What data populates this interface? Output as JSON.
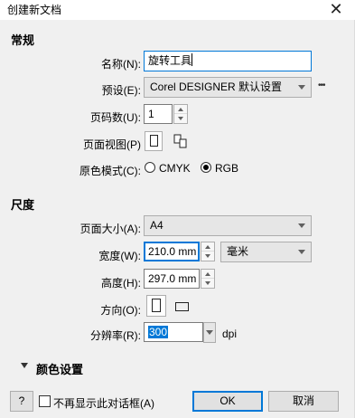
{
  "window": {
    "title": "创建新文档",
    "close_glyph": "✕"
  },
  "sections": {
    "general": "常规",
    "size": "尺度",
    "color": "颜色设置"
  },
  "fields": {
    "name_label": "名称(N):",
    "name_value": "旋转工具",
    "preset_label": "预设(E):",
    "preset_value": "Corel DESIGNER 默认设置",
    "more_glyph": "•••",
    "pages_label": "页码数(U):",
    "pages_value": "1",
    "page_view_label": "页面视图(P)",
    "color_mode_label": "原色模式(C):",
    "cmyk_label": "CMYK",
    "rgb_label": "RGB",
    "color_mode_selected": "RGB",
    "page_size_label": "页面大小(A):",
    "page_size_value": "A4",
    "width_label": "宽度(W):",
    "width_value": "210.0 mm",
    "units_value": "毫米",
    "height_label": "高度(H):",
    "height_value": "297.0 mm",
    "orientation_label": "方向(O):",
    "resolution_label": "分辨率(R):",
    "resolution_value": "300",
    "resolution_unit": "dpi"
  },
  "footer": {
    "help_label": "?",
    "dont_show_label": "不再显示此对话框(A)",
    "ok_label": "OK",
    "cancel_label": "取消"
  },
  "colors": {
    "accent": "#0078d7",
    "dialog_bg": "#f0f0f0"
  }
}
